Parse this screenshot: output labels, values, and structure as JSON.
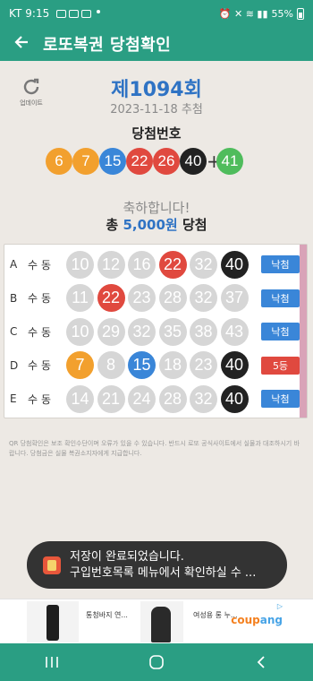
{
  "status_bar": {
    "carrier": "KT",
    "time": "9:15",
    "battery": "55%"
  },
  "app_bar": {
    "back_icon": "arrow-left-icon",
    "title": "로또복권 당첨확인"
  },
  "refresh": {
    "icon": "refresh-icon",
    "label": "업데이트"
  },
  "draw": {
    "round": "제1094회",
    "date": "2023-11-18 추첨",
    "winning_label": "당첨번호",
    "numbers": [
      {
        "n": "6",
        "color": "#f2a02e"
      },
      {
        "n": "7",
        "color": "#f2a02e"
      },
      {
        "n": "15",
        "color": "#3a86d8"
      },
      {
        "n": "22",
        "color": "#e0493f"
      },
      {
        "n": "26",
        "color": "#e0493f"
      },
      {
        "n": "40",
        "color": "#222222"
      }
    ],
    "plus": "+",
    "bonus": {
      "n": "41",
      "color": "#4fbc5c"
    }
  },
  "result": {
    "congrats": "축하합니다!",
    "prize_prefix": "총",
    "prize_amount": "5,000원",
    "prize_suffix": "당첨"
  },
  "rows": [
    {
      "letter": "A",
      "mode": "수동",
      "balls": [
        {
          "n": "10",
          "color": null
        },
        {
          "n": "12",
          "color": null
        },
        {
          "n": "16",
          "color": null
        },
        {
          "n": "22",
          "color": "#e0493f"
        },
        {
          "n": "32",
          "color": null
        },
        {
          "n": "40",
          "color": "#222222"
        }
      ],
      "result": "낙첨",
      "result_color": "#3a86d8"
    },
    {
      "letter": "B",
      "mode": "수동",
      "balls": [
        {
          "n": "11",
          "color": null
        },
        {
          "n": "22",
          "color": "#e0493f"
        },
        {
          "n": "23",
          "color": null
        },
        {
          "n": "28",
          "color": null
        },
        {
          "n": "32",
          "color": null
        },
        {
          "n": "37",
          "color": null
        }
      ],
      "result": "낙첨",
      "result_color": "#3a86d8"
    },
    {
      "letter": "C",
      "mode": "수동",
      "balls": [
        {
          "n": "10",
          "color": null
        },
        {
          "n": "29",
          "color": null
        },
        {
          "n": "32",
          "color": null
        },
        {
          "n": "35",
          "color": null
        },
        {
          "n": "38",
          "color": null
        },
        {
          "n": "43",
          "color": null
        }
      ],
      "result": "낙첨",
      "result_color": "#3a86d8"
    },
    {
      "letter": "D",
      "mode": "수동",
      "balls": [
        {
          "n": "7",
          "color": "#f2a02e"
        },
        {
          "n": "8",
          "color": null
        },
        {
          "n": "15",
          "color": "#3a86d8"
        },
        {
          "n": "18",
          "color": null
        },
        {
          "n": "23",
          "color": null
        },
        {
          "n": "40",
          "color": "#222222"
        }
      ],
      "result": "5등",
      "result_color": "#e0493f"
    },
    {
      "letter": "E",
      "mode": "수동",
      "balls": [
        {
          "n": "14",
          "color": null
        },
        {
          "n": "21",
          "color": null
        },
        {
          "n": "24",
          "color": null
        },
        {
          "n": "28",
          "color": null
        },
        {
          "n": "32",
          "color": null
        },
        {
          "n": "40",
          "color": "#222222"
        }
      ],
      "result": "낙첨",
      "result_color": "#3a86d8"
    }
  ],
  "notice": "QR 당첨확인은 보조 확인수단이며 오류가 있을 수 있습니다. 반드시 로또 공식사이트에서 실물과 대조하시기 바랍니다. 당첨금은 실물 복권소지자에게 지급합니다.",
  "toast": {
    "line1": "저장이 완료되었습니다.",
    "line2": "구입번호목록 메뉴에서 확인하실 수 ..."
  },
  "ad": {
    "item1": "통청바지 연...",
    "item2": "여성용 롱 누...",
    "brand_a": "coup",
    "brand_b": "ang"
  },
  "nav": {
    "recents_icon": "recents-icon",
    "home_icon": "home-icon",
    "back_icon": "back-icon"
  }
}
